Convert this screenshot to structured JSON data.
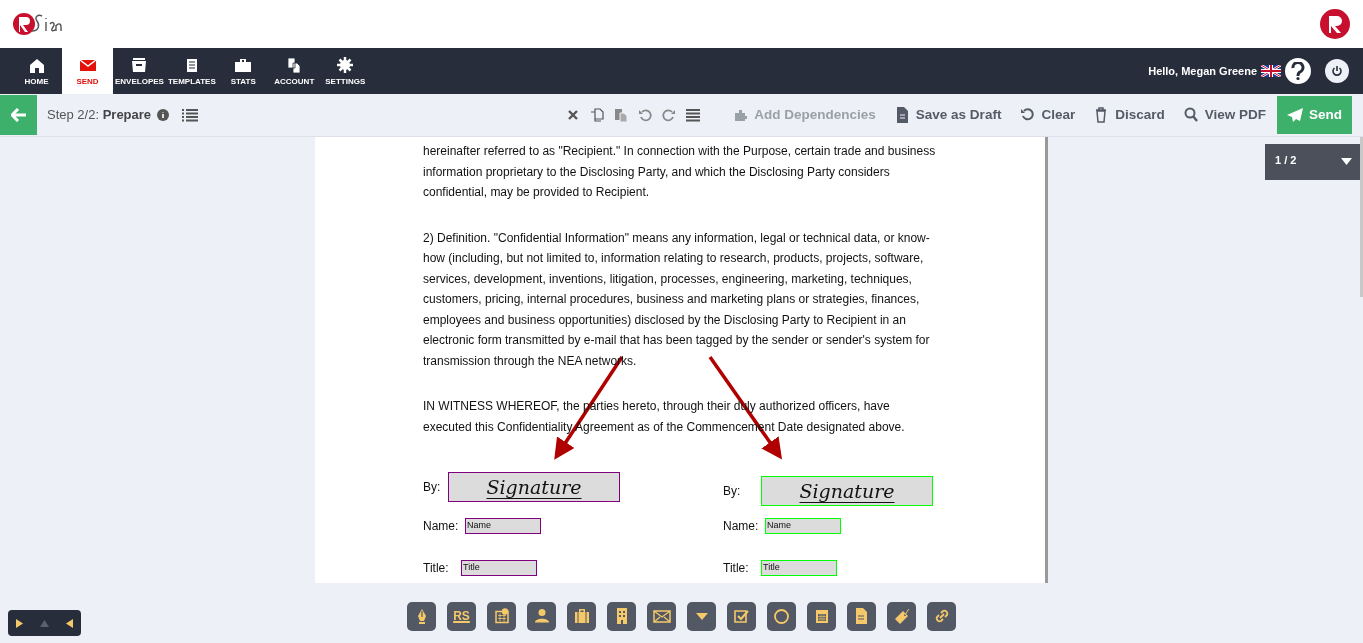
{
  "nav": [
    {
      "label": "HOME",
      "selected": false
    },
    {
      "label": "SEND",
      "selected": true
    },
    {
      "label": "ENVELOPES",
      "selected": false
    },
    {
      "label": "TEMPLATES",
      "selected": false
    },
    {
      "label": "STATS",
      "selected": false
    },
    {
      "label": "ACCOUNT",
      "selected": false
    },
    {
      "label": "SETTINGS",
      "selected": false
    }
  ],
  "greeting": "Hello, Megan Greene",
  "step": {
    "prefix": "Step 2/2:",
    "name": "Prepare"
  },
  "actions": [
    {
      "label": "Add Dependencies",
      "disabled": true
    },
    {
      "label": "Save as Draft",
      "disabled": false
    },
    {
      "label": "Clear",
      "disabled": false
    },
    {
      "label": "Discard",
      "disabled": false
    },
    {
      "label": "View PDF",
      "disabled": false
    }
  ],
  "send_label": "Send",
  "page_selector": "1 / 2",
  "document": {
    "paragraphs": [
      "hereinafter referred to as \"Recipient.\"  In connection with the Purpose, certain trade and business information proprietary to the Disclosing Party, and which the Disclosing Party considers confidential, may be provided to Recipient.",
      "2) Definition.  \"Confidential Information\" means any information, legal or technical data, or know-how (including, but not limited to, information relating to research, products, projects, software, services, development, inventions, litigation, processes, engineering, marketing, techniques, customers, pricing, internal procedures, business and marketing plans or strategies, finances, employees and business opportunities) disclosed by the Disclosing Party to Recipient in an electronic form transmitted by e-mail that has been tagged by the sender or sender's system for transmission through the NEA networks.",
      "IN WITNESS WHEREOF, the parties hereto, through their duly authorized officers, have executed this Confidentiality Agreement as of the Commencement Date designated above."
    ],
    "signers": [
      {
        "color": "#800080",
        "by": "By:",
        "signature": "Signature",
        "name_label": "Name:",
        "name_field": "Name",
        "title_label": "Title:",
        "title_field": "Title"
      },
      {
        "color": "#00ff00",
        "by": "By:",
        "signature": "Signature",
        "name_label": "Name:",
        "name_field": "Name",
        "title_label": "Title:",
        "title_field": "Title"
      }
    ]
  },
  "rs_label": "RS"
}
